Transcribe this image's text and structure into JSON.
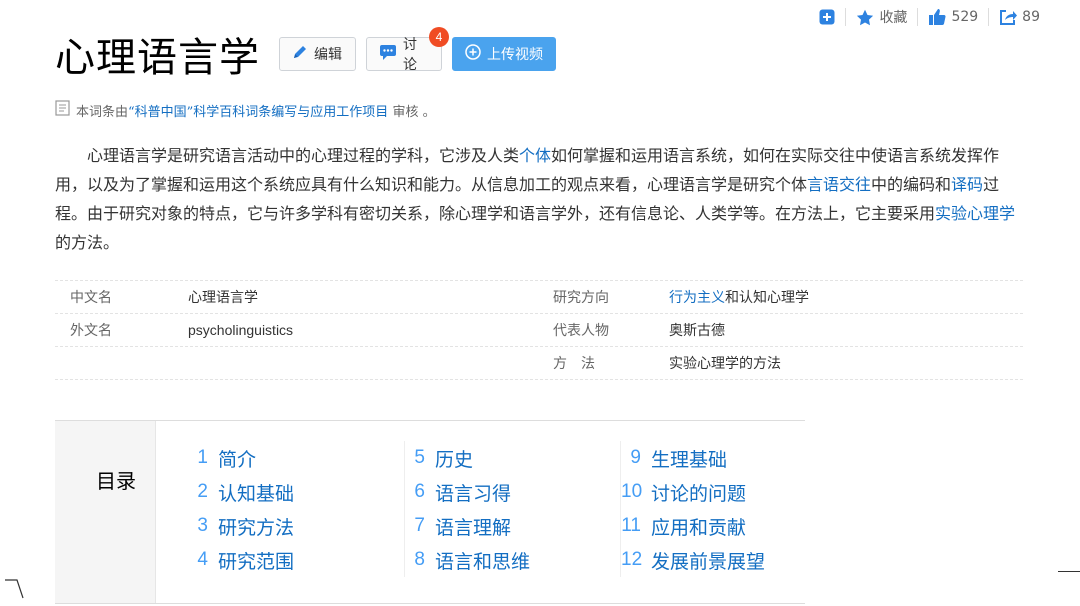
{
  "toolbar": {
    "favorite_label": "收藏",
    "like_count": "529",
    "share_count": "89"
  },
  "title": "心理语言学",
  "actions": {
    "edit_label": "编辑",
    "discuss_label": "讨论",
    "discuss_badge": "4",
    "upload_label": "上传视频"
  },
  "audit": {
    "prefix": "本词条由",
    "org": "“科普中国”科学百科词条编写与应用工作项目",
    "suffix": " 审核 。"
  },
  "summary": {
    "t1": "心理语言学是研究语言活动中的心理过程的学科，它涉及人类",
    "l1": "个体",
    "t2": "如何掌握和运用语言系统，如何在实际交往中使语言系统发挥作用，以及为了掌握和运用这个系统应具有什么知识和能力。从信息加工的观点来看，心理语言学是研究个体",
    "l2": "言语交往",
    "t3": "中的编码和",
    "l3": "译码",
    "t4": "过程。由于研究对象的特点，它与许多学科有密切关系，除心理学和语言学外，还有信息论、人类学等。在方法上，它主要采用",
    "l4": "实验心理学",
    "t5": "的方法。"
  },
  "info": {
    "r1": {
      "k1": "中文名",
      "v1": "心理语言学",
      "k2": "研究方向",
      "v2_link": "行为主义",
      "v2_rest": "和认知心理学"
    },
    "r2": {
      "k1": "外文名",
      "v1": "psycholinguistics",
      "k2": "代表人物",
      "v2": "奥斯古德"
    },
    "r3": {
      "k2": "方　法",
      "v2": "实验心理学的方法"
    }
  },
  "catalog": {
    "heading": "目录",
    "items": [
      {
        "num": "1",
        "label": "简介"
      },
      {
        "num": "2",
        "label": "认知基础"
      },
      {
        "num": "3",
        "label": "研究方法"
      },
      {
        "num": "4",
        "label": "研究范围"
      },
      {
        "num": "5",
        "label": "历史"
      },
      {
        "num": "6",
        "label": "语言习得"
      },
      {
        "num": "7",
        "label": "语言理解"
      },
      {
        "num": "8",
        "label": "语言和思维"
      },
      {
        "num": "9",
        "label": "生理基础"
      },
      {
        "num": "10",
        "label": "讨论的问题"
      },
      {
        "num": "11",
        "label": "应用和贡献"
      },
      {
        "num": "12",
        "label": "发展前景展望"
      }
    ]
  },
  "colors": {
    "link": "#136ec2",
    "accent": "#4aa3ee",
    "badge": "#f04c24"
  }
}
